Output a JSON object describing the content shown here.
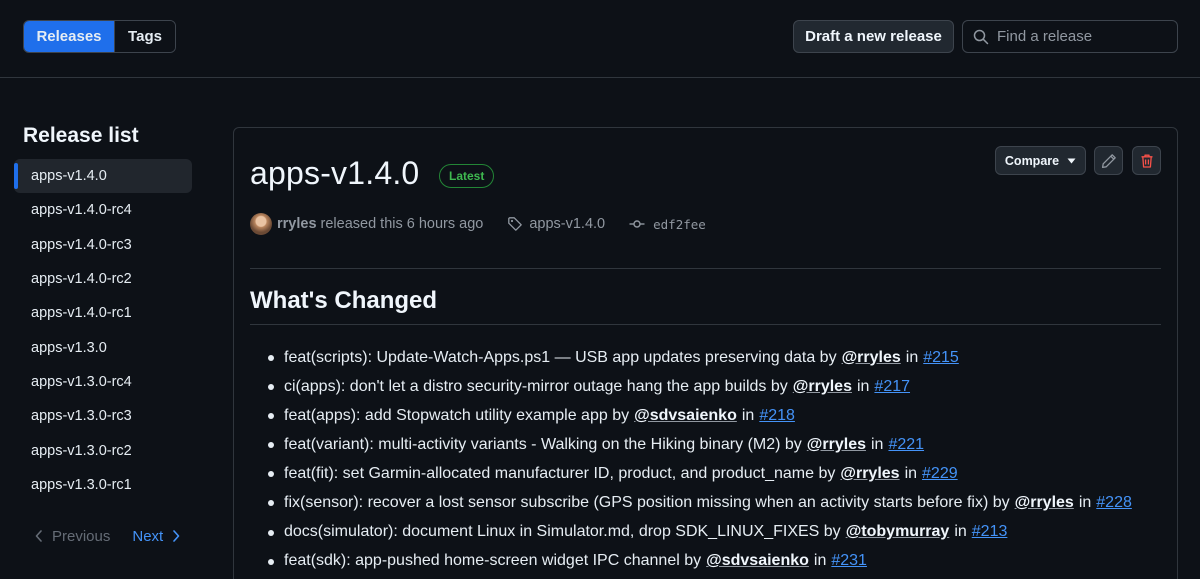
{
  "header": {
    "tabs": [
      {
        "label": "Releases",
        "active": true
      },
      {
        "label": "Tags",
        "active": false
      }
    ],
    "draft_label": "Draft a new release",
    "search_placeholder": "Find a release"
  },
  "sidebar": {
    "title": "Release list",
    "items": [
      "apps-v1.4.0",
      "apps-v1.4.0-rc4",
      "apps-v1.4.0-rc3",
      "apps-v1.4.0-rc2",
      "apps-v1.4.0-rc1",
      "apps-v1.3.0",
      "apps-v1.3.0-rc4",
      "apps-v1.3.0-rc3",
      "apps-v1.3.0-rc2",
      "apps-v1.3.0-rc1"
    ],
    "selected_index": 0,
    "prev_label": "Previous",
    "next_label": "Next"
  },
  "release": {
    "title": "apps-v1.4.0",
    "badge": "Latest",
    "compare_label": "Compare",
    "author": "rryles",
    "released_text": "released this 6 hours ago",
    "tag": "apps-v1.4.0",
    "commit": "edf2fee",
    "section_heading": "What's Changed",
    "changes": [
      {
        "text": "feat(scripts): Update-Watch-Apps.ps1 — USB app updates preserving data by",
        "user": "@rryles",
        "in": "in",
        "pr": "#215"
      },
      {
        "text": "ci(apps): don't let a distro security-mirror outage hang the app builds by",
        "user": "@rryles",
        "in": "in",
        "pr": "#217"
      },
      {
        "text": "feat(apps): add Stopwatch utility example app by",
        "user": "@sdvsaienko",
        "in": "in",
        "pr": "#218"
      },
      {
        "text": "feat(variant): multi-activity variants - Walking on the Hiking binary (M2) by",
        "user": "@rryles",
        "in": "in",
        "pr": "#221"
      },
      {
        "text": "feat(fit): set Garmin-allocated manufacturer ID, product, and product_name by",
        "user": "@rryles",
        "in": "in",
        "pr": "#229"
      },
      {
        "text": "fix(sensor): recover a lost sensor subscribe (GPS position missing when an activity starts before fix) by",
        "user": "@rryles",
        "in": "in",
        "pr": "#228"
      },
      {
        "text": "docs(simulator): document Linux in Simulator.md, drop SDK_LINUX_FIXES by",
        "user": "@tobymurray",
        "in": "in",
        "pr": "#213"
      },
      {
        "text": "feat(sdk): app-pushed home-screen widget IPC channel by",
        "user": "@sdvsaienko",
        "in": "in",
        "pr": "#231"
      }
    ]
  },
  "colors": {
    "accent": "#1f6feb",
    "link": "#4493f8",
    "badge_green": "#3fb950",
    "danger": "#f85149",
    "background": "#0d1117"
  }
}
